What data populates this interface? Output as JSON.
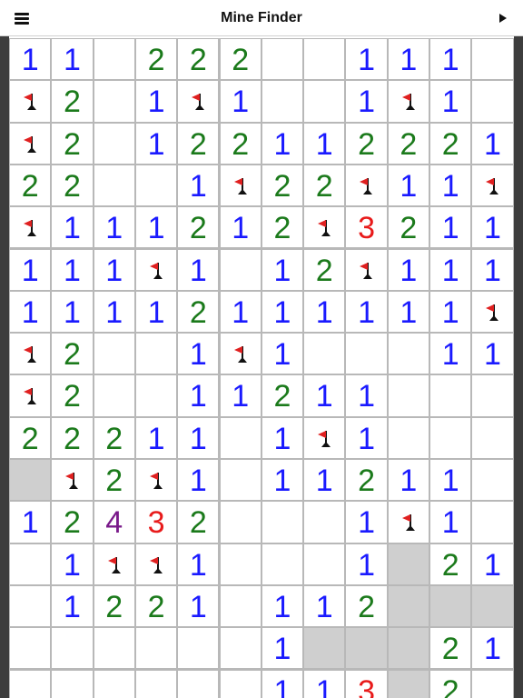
{
  "header": {
    "title": "Mine Finder"
  },
  "palette": {
    "1": "#1a1aff",
    "2": "#1b7a1b",
    "3": "#e81a1a",
    "4": "#7a1a8a"
  },
  "board": {
    "rows": [
      [
        "1",
        "1",
        "",
        "2",
        "2",
        "2",
        "",
        "",
        "1",
        "1",
        "1",
        ""
      ],
      [
        "F",
        "2",
        "",
        "1",
        "F",
        "1",
        "",
        "",
        "1",
        "F",
        "1",
        ""
      ],
      [
        "F",
        "2",
        "",
        "1",
        "2",
        "2",
        "1",
        "1",
        "2",
        "2",
        "2",
        "1"
      ],
      [
        "2",
        "2",
        "",
        "",
        "1",
        "F",
        "2",
        "2",
        "F",
        "1",
        "1",
        "F"
      ],
      [
        "F",
        "1",
        "1",
        "1",
        "2",
        "1",
        "2",
        "F",
        "3",
        "2",
        "1",
        "1"
      ],
      [
        "1",
        "1",
        "1",
        "F",
        "1",
        "",
        "1",
        "2",
        "F",
        "1",
        "1",
        "1"
      ],
      [
        "1",
        "1",
        "1",
        "1",
        "2",
        "1",
        "1",
        "1",
        "1",
        "1",
        "1",
        "F"
      ],
      [
        "F",
        "2",
        "",
        "",
        "1",
        "F",
        "1",
        "",
        "",
        "",
        "1",
        "1"
      ],
      [
        "F",
        "2",
        "",
        "",
        "1",
        "1",
        "2",
        "1",
        "1",
        "",
        "",
        ""
      ],
      [
        "2",
        "2",
        "2",
        "1",
        "1",
        "",
        "1",
        "F",
        "1",
        "",
        "",
        ""
      ],
      [
        "#",
        "F",
        "2",
        "F",
        "1",
        "",
        "1",
        "1",
        "2",
        "1",
        "1",
        ""
      ],
      [
        "1",
        "2",
        "4",
        "3",
        "2",
        "",
        "",
        "",
        "1",
        "F",
        "1",
        ""
      ],
      [
        "",
        "1",
        "F",
        "F",
        "1",
        "",
        "",
        "",
        "1",
        "#",
        "2",
        "1"
      ],
      [
        "",
        "1",
        "2",
        "2",
        "1",
        "",
        "1",
        "1",
        "2",
        "#",
        "#",
        "#"
      ],
      [
        "",
        "",
        "",
        "",
        "",
        "",
        "1",
        "#",
        "#",
        "#",
        "2",
        "1"
      ],
      [
        "",
        "",
        "",
        "",
        "",
        "",
        "1",
        "1",
        "3",
        "#",
        "2",
        ""
      ]
    ]
  }
}
